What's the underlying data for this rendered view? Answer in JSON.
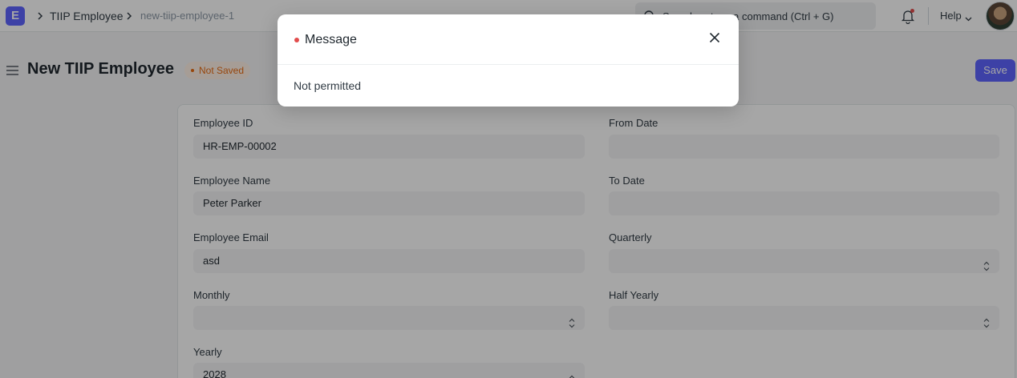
{
  "navbar": {
    "logo_letter": "E",
    "breadcrumbs": [
      "TIIP Employee",
      "new-tiip-employee-1"
    ],
    "search_placeholder": "Search or type a command (Ctrl + G)",
    "help_label": "Help",
    "icons": [
      "app-logo",
      "chevron-right-icon",
      "search-icon",
      "bell-icon",
      "chevron-down-icon",
      "avatar"
    ]
  },
  "page": {
    "title": "New TIIP Employee",
    "status": "Not Saved",
    "save_label": "Save"
  },
  "form": {
    "fields": [
      {
        "label": "Employee ID",
        "value": "HR-EMP-00002"
      },
      {
        "label": "From Date",
        "value": ""
      },
      {
        "label": "Employee Name",
        "value": "Peter Parker"
      },
      {
        "label": "To Date",
        "value": ""
      },
      {
        "label": "Employee Email",
        "value": "asd"
      },
      {
        "label": "Quarterly",
        "value": ""
      },
      {
        "label": "Monthly",
        "value": ""
      },
      {
        "label": "Half Yearly",
        "value": ""
      },
      {
        "label": "Yearly",
        "value": "2028"
      }
    ]
  },
  "dialog": {
    "title": "Message",
    "body": "Not permitted",
    "indicator_color": "#e24c4c"
  },
  "colors": {
    "accent": "#5e64ff",
    "warning": "#e86c13"
  }
}
